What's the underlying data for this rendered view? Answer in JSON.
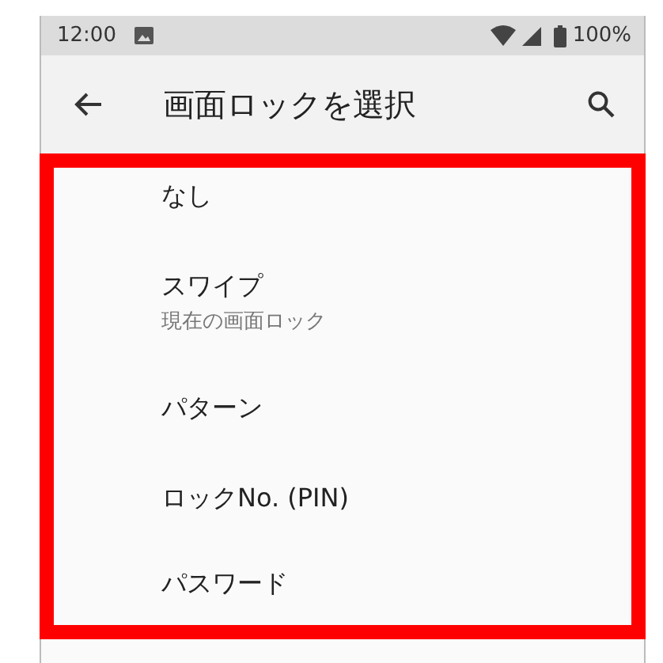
{
  "status_bar": {
    "time": "12:00",
    "battery": "100%"
  },
  "app_bar": {
    "title": "画面ロックを選択"
  },
  "options": [
    {
      "title": "なし"
    },
    {
      "title": "スワイプ",
      "subtitle": "現在の画面ロック"
    },
    {
      "title": "パターン"
    },
    {
      "title": "ロックNo. (PIN)"
    },
    {
      "title": "パスワード"
    }
  ]
}
